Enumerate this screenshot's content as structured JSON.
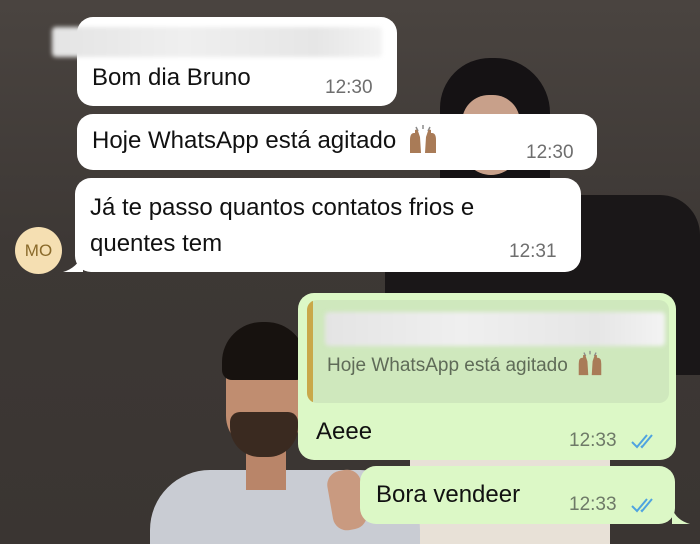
{
  "avatar": {
    "initials": "MO"
  },
  "messages": [
    {
      "id": "m1",
      "text": "Bom dia Bruno",
      "time": "12:30",
      "direction": "incoming",
      "sender_hidden": true
    },
    {
      "id": "m2",
      "text": "Hoje WhatsApp está agitado",
      "emoji": "raising-hands-emoji",
      "time": "12:30",
      "direction": "incoming"
    },
    {
      "id": "m3",
      "line1": "Já te passo quantos contatos frios e",
      "line2": "quentes tem",
      "time": "12:31",
      "direction": "incoming"
    },
    {
      "id": "m4",
      "text": "Aeee",
      "time": "12:33",
      "direction": "outgoing",
      "status": "read",
      "quote": {
        "author_hidden": true,
        "text": "Hoje WhatsApp está agitado",
        "emoji": "raising-hands-emoji"
      }
    },
    {
      "id": "m5",
      "text": "Bora vendeer",
      "time": "12:33",
      "direction": "outgoing",
      "status": "read"
    }
  ],
  "colors": {
    "incoming_bubble": "#ffffff",
    "outgoing_bubble": "#dcf8c6",
    "read_ticks": "#4fa3e0",
    "avatar_bg": "#f5dfb2"
  }
}
